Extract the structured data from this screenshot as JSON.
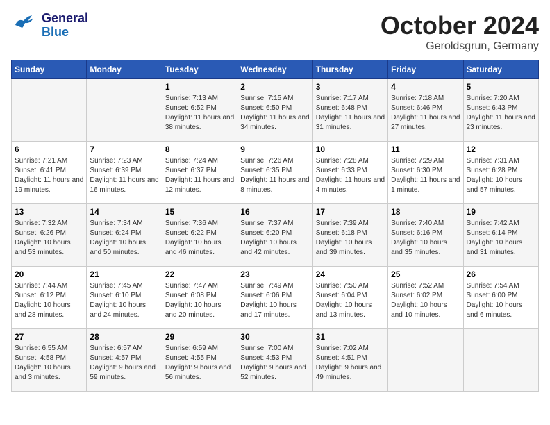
{
  "header": {
    "logo_line1": "General",
    "logo_line2": "Blue",
    "month": "October 2024",
    "location": "Geroldsgrun, Germany"
  },
  "weekdays": [
    "Sunday",
    "Monday",
    "Tuesday",
    "Wednesday",
    "Thursday",
    "Friday",
    "Saturday"
  ],
  "weeks": [
    [
      {
        "day": "",
        "info": ""
      },
      {
        "day": "",
        "info": ""
      },
      {
        "day": "1",
        "info": "Sunrise: 7:13 AM\nSunset: 6:52 PM\nDaylight: 11 hours and 38 minutes."
      },
      {
        "day": "2",
        "info": "Sunrise: 7:15 AM\nSunset: 6:50 PM\nDaylight: 11 hours and 34 minutes."
      },
      {
        "day": "3",
        "info": "Sunrise: 7:17 AM\nSunset: 6:48 PM\nDaylight: 11 hours and 31 minutes."
      },
      {
        "day": "4",
        "info": "Sunrise: 7:18 AM\nSunset: 6:46 PM\nDaylight: 11 hours and 27 minutes."
      },
      {
        "day": "5",
        "info": "Sunrise: 7:20 AM\nSunset: 6:43 PM\nDaylight: 11 hours and 23 minutes."
      }
    ],
    [
      {
        "day": "6",
        "info": "Sunrise: 7:21 AM\nSunset: 6:41 PM\nDaylight: 11 hours and 19 minutes."
      },
      {
        "day": "7",
        "info": "Sunrise: 7:23 AM\nSunset: 6:39 PM\nDaylight: 11 hours and 16 minutes."
      },
      {
        "day": "8",
        "info": "Sunrise: 7:24 AM\nSunset: 6:37 PM\nDaylight: 11 hours and 12 minutes."
      },
      {
        "day": "9",
        "info": "Sunrise: 7:26 AM\nSunset: 6:35 PM\nDaylight: 11 hours and 8 minutes."
      },
      {
        "day": "10",
        "info": "Sunrise: 7:28 AM\nSunset: 6:33 PM\nDaylight: 11 hours and 4 minutes."
      },
      {
        "day": "11",
        "info": "Sunrise: 7:29 AM\nSunset: 6:30 PM\nDaylight: 11 hours and 1 minute."
      },
      {
        "day": "12",
        "info": "Sunrise: 7:31 AM\nSunset: 6:28 PM\nDaylight: 10 hours and 57 minutes."
      }
    ],
    [
      {
        "day": "13",
        "info": "Sunrise: 7:32 AM\nSunset: 6:26 PM\nDaylight: 10 hours and 53 minutes."
      },
      {
        "day": "14",
        "info": "Sunrise: 7:34 AM\nSunset: 6:24 PM\nDaylight: 10 hours and 50 minutes."
      },
      {
        "day": "15",
        "info": "Sunrise: 7:36 AM\nSunset: 6:22 PM\nDaylight: 10 hours and 46 minutes."
      },
      {
        "day": "16",
        "info": "Sunrise: 7:37 AM\nSunset: 6:20 PM\nDaylight: 10 hours and 42 minutes."
      },
      {
        "day": "17",
        "info": "Sunrise: 7:39 AM\nSunset: 6:18 PM\nDaylight: 10 hours and 39 minutes."
      },
      {
        "day": "18",
        "info": "Sunrise: 7:40 AM\nSunset: 6:16 PM\nDaylight: 10 hours and 35 minutes."
      },
      {
        "day": "19",
        "info": "Sunrise: 7:42 AM\nSunset: 6:14 PM\nDaylight: 10 hours and 31 minutes."
      }
    ],
    [
      {
        "day": "20",
        "info": "Sunrise: 7:44 AM\nSunset: 6:12 PM\nDaylight: 10 hours and 28 minutes."
      },
      {
        "day": "21",
        "info": "Sunrise: 7:45 AM\nSunset: 6:10 PM\nDaylight: 10 hours and 24 minutes."
      },
      {
        "day": "22",
        "info": "Sunrise: 7:47 AM\nSunset: 6:08 PM\nDaylight: 10 hours and 20 minutes."
      },
      {
        "day": "23",
        "info": "Sunrise: 7:49 AM\nSunset: 6:06 PM\nDaylight: 10 hours and 17 minutes."
      },
      {
        "day": "24",
        "info": "Sunrise: 7:50 AM\nSunset: 6:04 PM\nDaylight: 10 hours and 13 minutes."
      },
      {
        "day": "25",
        "info": "Sunrise: 7:52 AM\nSunset: 6:02 PM\nDaylight: 10 hours and 10 minutes."
      },
      {
        "day": "26",
        "info": "Sunrise: 7:54 AM\nSunset: 6:00 PM\nDaylight: 10 hours and 6 minutes."
      }
    ],
    [
      {
        "day": "27",
        "info": "Sunrise: 6:55 AM\nSunset: 4:58 PM\nDaylight: 10 hours and 3 minutes."
      },
      {
        "day": "28",
        "info": "Sunrise: 6:57 AM\nSunset: 4:57 PM\nDaylight: 9 hours and 59 minutes."
      },
      {
        "day": "29",
        "info": "Sunrise: 6:59 AM\nSunset: 4:55 PM\nDaylight: 9 hours and 56 minutes."
      },
      {
        "day": "30",
        "info": "Sunrise: 7:00 AM\nSunset: 4:53 PM\nDaylight: 9 hours and 52 minutes."
      },
      {
        "day": "31",
        "info": "Sunrise: 7:02 AM\nSunset: 4:51 PM\nDaylight: 9 hours and 49 minutes."
      },
      {
        "day": "",
        "info": ""
      },
      {
        "day": "",
        "info": ""
      }
    ]
  ]
}
